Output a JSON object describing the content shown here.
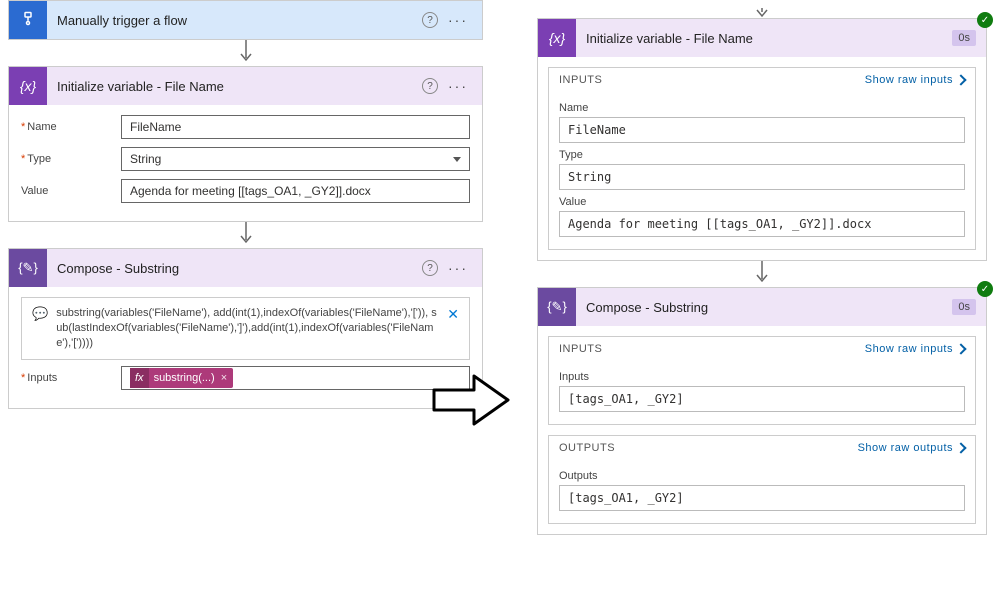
{
  "left": {
    "trigger": {
      "title": "Manually trigger a flow"
    },
    "init": {
      "title": "Initialize variable - File Name",
      "name_label": "Name",
      "name_value": "FileName",
      "type_label": "Type",
      "type_value": "String",
      "value_label": "Value",
      "value_value": "Agenda for meeting [[tags_OA1, _GY2]].docx"
    },
    "compose": {
      "title": "Compose - Substring",
      "expr_text": "substring(variables('FileName'), add(int(1),indexOf(variables('FileName'),'[')), sub(lastIndexOf(variables('FileName'),']'),add(int(1),indexOf(variables('FileName'),'['))))",
      "inputs_label": "Inputs",
      "token_fx": "fx",
      "token_text": "substring(...)"
    }
  },
  "right": {
    "init": {
      "title": "Initialize variable - File Name",
      "badge": "0s",
      "section_inputs": "INPUTS",
      "show_raw_inputs": "Show raw inputs",
      "name_label": "Name",
      "name_value": "FileName",
      "type_label": "Type",
      "type_value": "String",
      "value_label": "Value",
      "value_value": "Agenda for meeting [[tags_OA1, _GY2]].docx"
    },
    "compose": {
      "title": "Compose - Substring",
      "badge": "0s",
      "section_inputs": "INPUTS",
      "show_raw_inputs": "Show raw inputs",
      "inputs_label": "Inputs",
      "inputs_value": "[tags_OA1, _GY2]",
      "section_outputs": "OUTPUTS",
      "show_raw_outputs": "Show raw outputs",
      "outputs_label": "Outputs",
      "outputs_value": "[tags_OA1, _GY2]"
    }
  }
}
